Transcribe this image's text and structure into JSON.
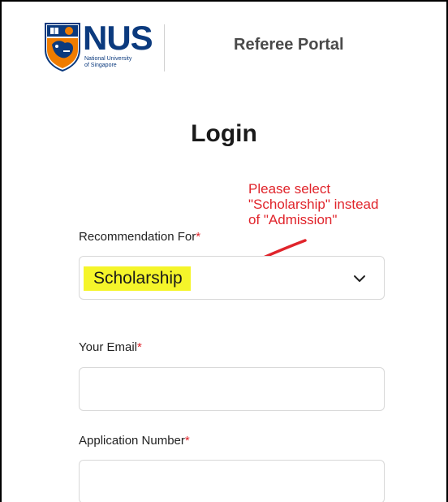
{
  "header": {
    "logo_word": "NUS",
    "logo_sub_line1": "National University",
    "logo_sub_line2": "of Singapore",
    "portal_title": "Referee Portal"
  },
  "login": {
    "title": "Login",
    "annotation_line1": "Please select",
    "annotation_line2": "\"Scholarship\" instead",
    "annotation_line3": "of \"Admission\"",
    "recommendation_label": "Recommendation For",
    "recommendation_value": "Scholarship",
    "email_label": "Your Email",
    "email_value": "",
    "application_label": "Application Number",
    "application_value": "",
    "required_marker": "*"
  },
  "colors": {
    "brand_blue": "#0b3a7e",
    "brand_orange": "#ef7c00",
    "annotation_red": "#e0242b",
    "highlight_yellow": "#f5f52a"
  }
}
